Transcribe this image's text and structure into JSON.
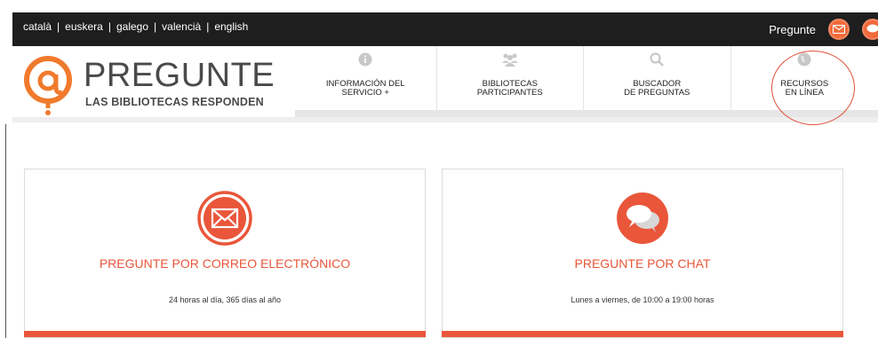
{
  "topbar": {
    "languages": [
      "català",
      "euskera",
      "galego",
      "valencià",
      "english"
    ],
    "pregunte_label": "Pregunte"
  },
  "logo": {
    "title": "PREGUNTE",
    "subtitle": "LAS BIBLIOTECAS RESPONDEN"
  },
  "nav": {
    "items": [
      {
        "label": "INFORMACIÓN DEL\nSERVICIO +",
        "icon": "info-icon"
      },
      {
        "label": "BIBLIOTECAS\nPARTICIPANTES",
        "icon": "people-icon"
      },
      {
        "label": "BUSCADOR\nDE PREGUNTAS",
        "icon": "search-icon"
      },
      {
        "label": "RECURSOS\nEN LÍNEA",
        "icon": "globe-icon"
      }
    ]
  },
  "cards": {
    "email": {
      "title": "PREGUNTE POR CORREO ELECTRÓNICO",
      "subtitle": "24 horas al día, 365 días al año",
      "icon": "envelope-icon"
    },
    "chat": {
      "title": "PREGUNTE POR CHAT",
      "subtitle": "Lunes a viernes, de 10:00 a 19:00 horas",
      "icon": "chat-icon"
    }
  },
  "colors": {
    "accent": "#e9563a",
    "topbar": "#1e1e1e",
    "nav_icon": "#c8c8c8"
  }
}
